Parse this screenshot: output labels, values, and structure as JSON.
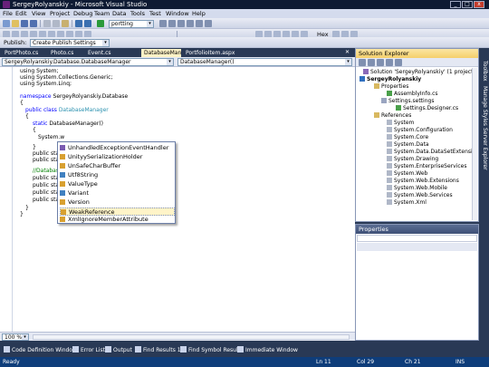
{
  "window": {
    "title": "SergeyRolyanskiy - Microsoft Visual Studio",
    "min": "_",
    "max": "□",
    "close": "x"
  },
  "menu": [
    "File",
    "Edit",
    "View",
    "Project",
    "Debug",
    "Team",
    "Data",
    "Tools",
    "Test",
    "Window",
    "Help"
  ],
  "toolbar": {
    "config_combo": "portting",
    "hex_label": "Hex",
    "publish_label": "Publish:",
    "publish_combo": "Create Publish Settings"
  },
  "tabs": [
    "PortPhoto.cs",
    "Photo.cs",
    "Event.cs",
    "DatabaseManager.cs*",
    "PortfolioItem.aspx"
  ],
  "nav": {
    "left": "SergeyRolyanskiy.Database.DatabaseManager",
    "right": "DatabaseManager()"
  },
  "code": {
    "l1": "using System;",
    "l2": "using System.Collections.Generic;",
    "l3": "using System.Linq;",
    "l4a": "namespace",
    "l4b": " SergeyRolyanskiy.Database",
    "l5": "{",
    "l6a": "public",
    "l6b": " ",
    "l6c": "class",
    "l6d": " ",
    "l6e": "DatabaseManager",
    "l7": "{",
    "l8a": "static",
    "l8b": " DatabaseManager()",
    "l9": "{",
    "l10": "System.w",
    "l11": "}",
    "l12": "public stati",
    "l13": "public stati",
    "l14": "//Database",
    "l15": "public stati",
    "l16": "public stati",
    "l17": "public stati",
    "l18": "public stati",
    "l19": "}",
    "l20": "}"
  },
  "intellisense": {
    "items": [
      "UnhandledExceptionEventHandler",
      "UnityySerializationHolder",
      "UnSafeCharBuffer",
      "Utf8String",
      "ValueType",
      "Variant",
      "Version",
      "WeakReference",
      "XmlIgnoreMemberAttribute"
    ],
    "selected": "WeakReference"
  },
  "zoom": "100 %",
  "solution_explorer": {
    "title": "Solution Explorer",
    "solution": "Solution 'SergeyRolyanskiy' (1 project)",
    "project": "SergeyRolyanskiy",
    "nodes": [
      "Properties",
      "AssemblyInfo.cs",
      "Settings.settings",
      "Settings.Designer.cs",
      "References",
      "System",
      "System.Configuration",
      "System.Core",
      "System.Data",
      "System.Data.DataSetExtensio",
      "System.Drawing",
      "System.EnterpriseServices",
      "System.Web",
      "System.Web.Extensions",
      "System.Web.Mobile",
      "System.Web.Services",
      "System.Xml"
    ]
  },
  "properties": {
    "title": "Properties"
  },
  "side_strip": [
    "Toolbox",
    "Manage Styles",
    "Server Explorer"
  ],
  "bottom_tabs": [
    "Code Definition Window",
    "Error List",
    "Output",
    "Find Results 1",
    "Find Symbol Results",
    "Immediate Window"
  ],
  "status": {
    "left": "Ready",
    "ln": "Ln 11",
    "col": "Col 29",
    "ch": "Ch 21",
    "mode": "INS"
  },
  "colors": {
    "frame": "#293955",
    "keyword": "#0000ff",
    "type": "#2b91af",
    "comment": "#008000"
  }
}
